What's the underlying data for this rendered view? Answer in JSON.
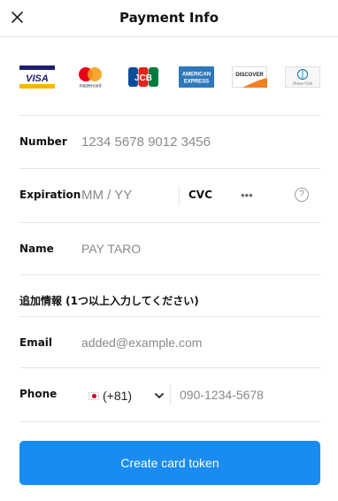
{
  "header": {
    "title": "Payment Info"
  },
  "brands": {
    "visa": "VISA",
    "mastercard": "mastercard",
    "jcb": "JCB",
    "amex_top": "AMERICAN",
    "amex_bottom": "EXPRESS",
    "discover": "DISCOVER",
    "diners": "Diners Club"
  },
  "fields": {
    "number": {
      "label": "Number",
      "placeholder": "1234 5678 9012 3456"
    },
    "expiration": {
      "label": "Expiration",
      "placeholder": "MM / YY"
    },
    "cvc": {
      "label": "CVC",
      "placeholder": "•••",
      "help": "?"
    },
    "name": {
      "label": "Name",
      "placeholder": "PAY TARO"
    }
  },
  "additional": {
    "title": "追加情報 (1つ以上入力してください)",
    "email": {
      "label": "Email",
      "placeholder": "added@example.com"
    },
    "phone": {
      "label": "Phone",
      "country_code": "(+81)",
      "placeholder": "090-1234-5678"
    }
  },
  "action": {
    "submit_label": "Create card token"
  },
  "colors": {
    "primary": "#1a8cf1",
    "visa_blue": "#1a1f71",
    "visa_gold": "#f7b600",
    "mc_red": "#eb001b",
    "mc_orange": "#f79e1b",
    "amex_blue": "#2e77bb",
    "discover_orange": "#f48120"
  }
}
